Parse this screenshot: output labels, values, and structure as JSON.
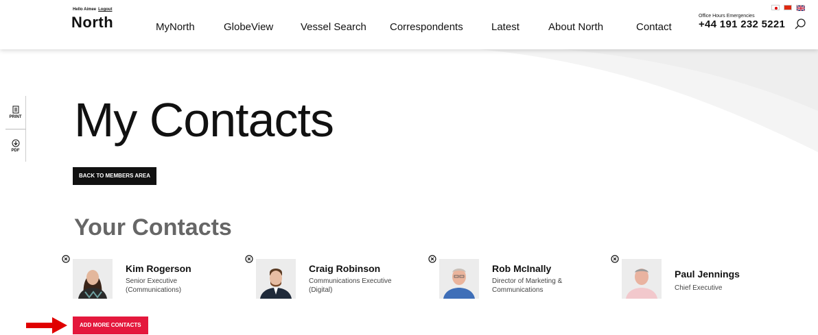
{
  "header": {
    "hello": "Hello Aimee",
    "logout": "Logout",
    "logo": "North",
    "nav": [
      "MyNorth",
      "GlobeView",
      "Vessel Search",
      "Correspondents",
      "Latest",
      "About North",
      "Contact"
    ],
    "office_hours": "Office Hours Emergencies",
    "phone": "+44 191 232 5221",
    "flags": [
      "japan-flag-icon",
      "china-flag-icon",
      "uk-flag-icon"
    ]
  },
  "side_tools": {
    "print_label": "PRINT",
    "pdf_label": "PDF"
  },
  "main": {
    "title": "My Contacts",
    "back_label": "BACK TO MEMBERS AREA",
    "section_title": "Your Contacts",
    "add_label": "ADD MORE CONTACTS"
  },
  "contacts": [
    {
      "name": "Kim Rogerson",
      "role": "Senior Executive (Communications)"
    },
    {
      "name": "Craig Robinson",
      "role": "Communications Executive (Digital)"
    },
    {
      "name": "Rob McInally",
      "role": "Director of Marketing & Communications"
    },
    {
      "name": "Paul Jennings",
      "role": "Chief Executive"
    }
  ],
  "colors": {
    "accent": "#e4183c",
    "dark": "#111111"
  }
}
